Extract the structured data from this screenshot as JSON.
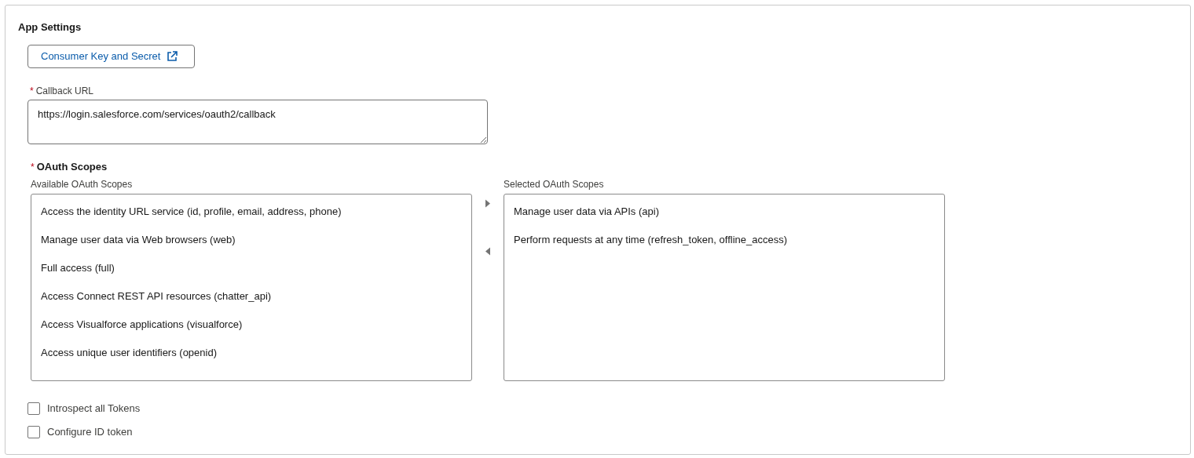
{
  "section": {
    "title": "App Settings"
  },
  "consumer_button": {
    "label": "Consumer Key and Secret"
  },
  "callback_url": {
    "required_mark": "*",
    "label": "Callback URL",
    "value": "https://login.salesforce.com/services/oauth2/callback"
  },
  "oauth_scopes": {
    "required_mark": "*",
    "title": "OAuth Scopes",
    "available": {
      "label": "Available OAuth Scopes",
      "items": [
        {
          "label": "Access the identity URL service (id, profile, email, address, phone)"
        },
        {
          "label": "Manage user data via Web browsers (web)"
        },
        {
          "label": "Full access (full)"
        },
        {
          "label": "Access Connect REST API resources (chatter_api)"
        },
        {
          "label": "Access Visualforce applications (visualforce)"
        },
        {
          "label": "Access unique user identifiers (openid)"
        }
      ]
    },
    "selected": {
      "label": "Selected OAuth Scopes",
      "items": [
        {
          "label": "Manage user data via APIs (api)"
        },
        {
          "label": "Perform requests at any time (refresh_token, offline_access)"
        }
      ]
    }
  },
  "options": [
    {
      "label": "Introspect all Tokens",
      "checked": false
    },
    {
      "label": "Configure ID token",
      "checked": false
    }
  ]
}
